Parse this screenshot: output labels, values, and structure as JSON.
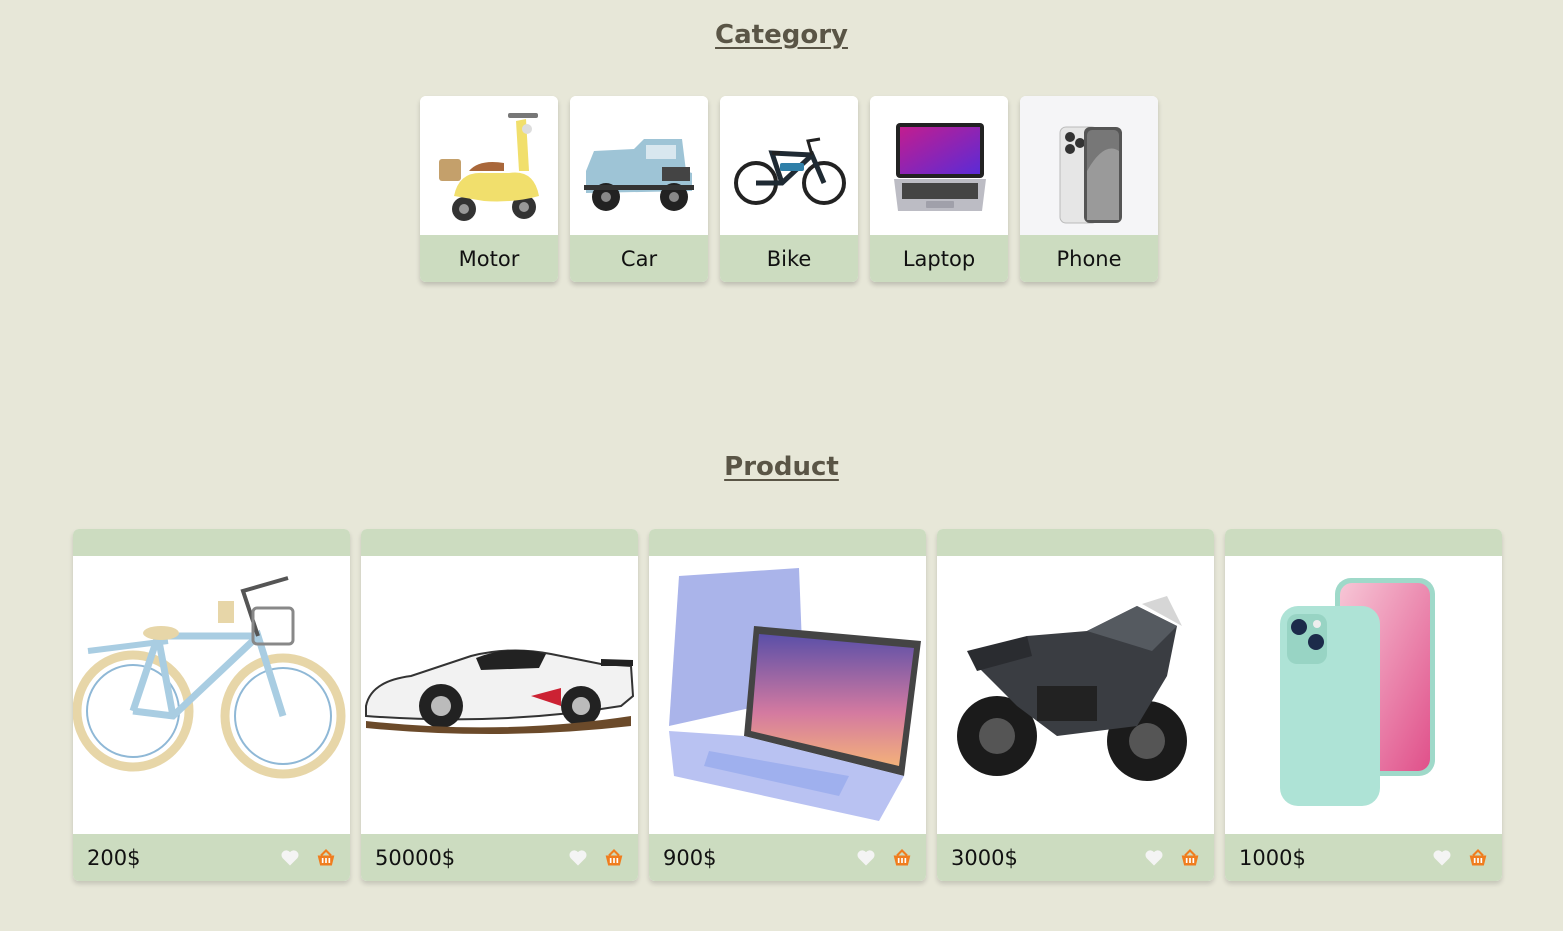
{
  "category": {
    "title": "Category",
    "items": [
      {
        "label": "Motor",
        "icon": "scooter-image"
      },
      {
        "label": "Car",
        "icon": "jeep-image"
      },
      {
        "label": "Bike",
        "icon": "ebike-image"
      },
      {
        "label": "Laptop",
        "icon": "laptop-image"
      },
      {
        "label": "Phone",
        "icon": "phone-image"
      }
    ]
  },
  "product": {
    "title": "Product",
    "items": [
      {
        "price": "200$",
        "icon": "bicycle-image"
      },
      {
        "price": "50000$",
        "icon": "sportscar-image"
      },
      {
        "price": "900$",
        "icon": "laptop-image"
      },
      {
        "price": "3000$",
        "icon": "motorcycle-image"
      },
      {
        "price": "1000$",
        "icon": "phone-image"
      }
    ]
  },
  "colors": {
    "background": "#e7e7d8",
    "card_band": "#ccdcc0",
    "title": "#5a5546",
    "basket": "#f07d1e",
    "heart": "#f4f4f4"
  }
}
